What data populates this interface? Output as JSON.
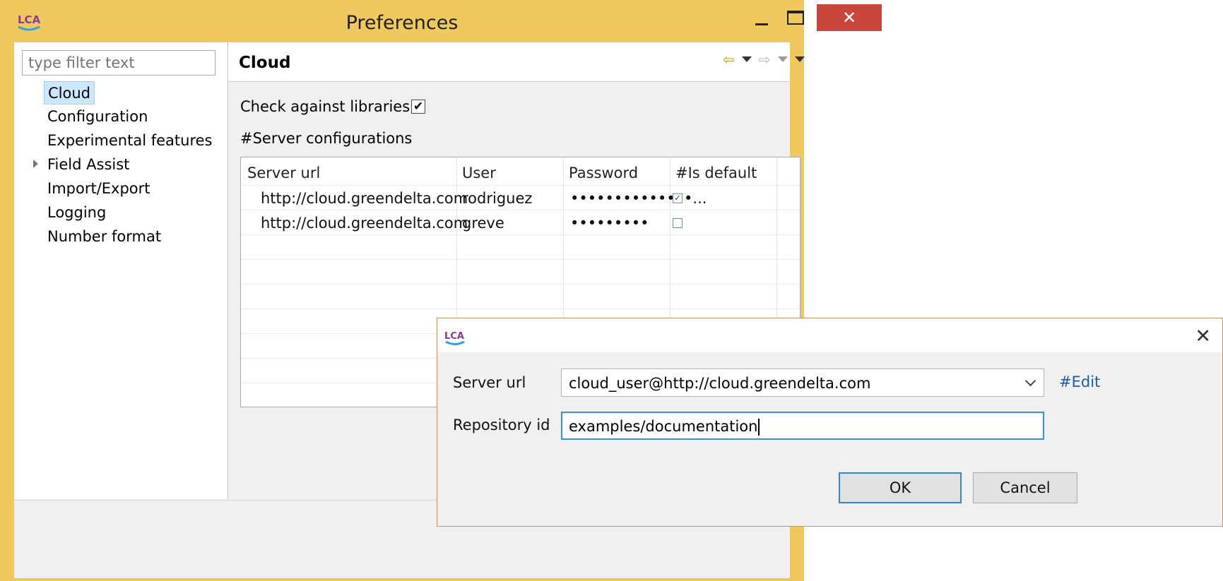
{
  "window": {
    "title": "Preferences",
    "icon": "lca-logo-icon"
  },
  "sidebar": {
    "filter_placeholder": "type filter text",
    "items": [
      {
        "label": "Cloud",
        "selected": true
      },
      {
        "label": "Configuration"
      },
      {
        "label": "Experimental features"
      },
      {
        "label": "Field Assist",
        "expandable": true
      },
      {
        "label": "Import/Export"
      },
      {
        "label": "Logging"
      },
      {
        "label": "Number format"
      }
    ]
  },
  "page": {
    "title": "Cloud",
    "check_libraries_label": "Check against libraries",
    "check_libraries_checked": true,
    "server_section_label": "#Server configurations"
  },
  "table": {
    "columns": [
      "Server url",
      "User",
      "Password",
      "#Is default"
    ],
    "rows": [
      {
        "url": "http://cloud.greendelta.com",
        "user": "rodriguez",
        "password": "••••••••••••••...",
        "is_default": true
      },
      {
        "url": "http://cloud.greendelta.com",
        "user": "greve",
        "password": "•••••••••",
        "is_default": false
      }
    ]
  },
  "dialog": {
    "server_url_label": "Server url",
    "server_url_value": "cloud_user@http://cloud.greendelta.com",
    "edit_label": "#Edit",
    "repository_label": "Repository id",
    "repository_value": "examples/documentation",
    "ok_label": "OK",
    "cancel_label": "Cancel",
    "close_glyph": "✕"
  },
  "colors": {
    "title_bar": "#F0C95E",
    "close_button": "#C9463D",
    "selection": "#CCE8FF",
    "link": "#1a5ea8",
    "focus": "#3c8ee0"
  }
}
